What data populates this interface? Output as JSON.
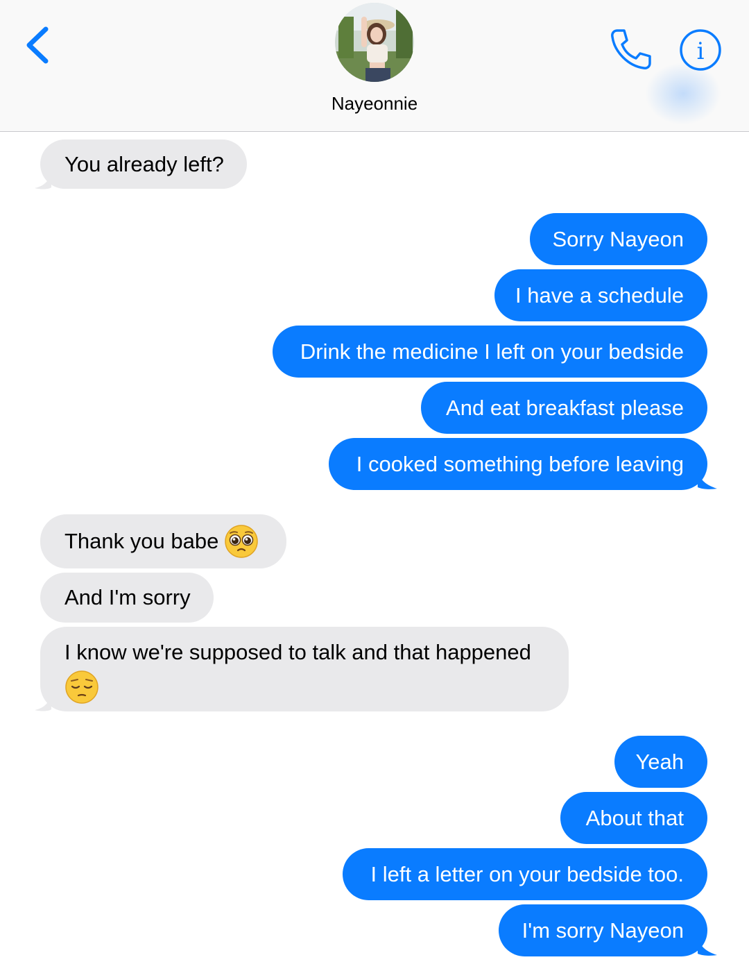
{
  "header": {
    "contact_name": "Nayeonnie",
    "accent_color": "#0a7cff",
    "back_icon": "chevron-left-icon",
    "call_icon": "phone-icon",
    "info_icon": "info-icon"
  },
  "messages": [
    {
      "direction": "incoming",
      "text": "You already left?"
    },
    {
      "direction": "outgoing",
      "text": "Sorry Nayeon"
    },
    {
      "direction": "outgoing",
      "text": "I have a schedule"
    },
    {
      "direction": "outgoing",
      "text": "Drink the medicine I left on your bedside"
    },
    {
      "direction": "outgoing",
      "text": "And eat breakfast please"
    },
    {
      "direction": "outgoing",
      "text": "I cooked something before leaving"
    },
    {
      "direction": "incoming",
      "text": "Thank you babe",
      "emoji": "pleading-face-icon"
    },
    {
      "direction": "incoming",
      "text": "And I'm sorry"
    },
    {
      "direction": "incoming",
      "text": "I know we're supposed to talk and that happened",
      "emoji": "pensive-face-icon"
    },
    {
      "direction": "outgoing",
      "text": "Yeah"
    },
    {
      "direction": "outgoing",
      "text": "About that"
    },
    {
      "direction": "outgoing",
      "text": "I left a letter on your bedside too."
    },
    {
      "direction": "outgoing",
      "text": "I'm sorry Nayeon"
    }
  ]
}
